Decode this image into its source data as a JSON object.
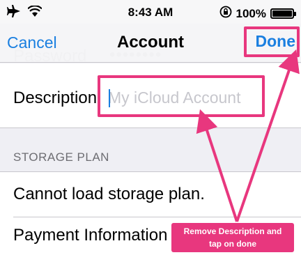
{
  "status_bar": {
    "airplane_icon": "airplane-icon",
    "wifi_icon": "wifi-icon",
    "time": "8:43 AM",
    "orientation_lock_icon": "orientation-lock-icon",
    "battery_percent": "100%",
    "battery_level": 1.0
  },
  "nav": {
    "cancel_label": "Cancel",
    "title": "Account",
    "done_label": "Done"
  },
  "background_row": {
    "label": "Password",
    "value": "••••••••"
  },
  "description": {
    "label": "Description",
    "placeholder": "My iCloud Account",
    "value": ""
  },
  "storage": {
    "header": "STORAGE PLAN",
    "status_text": "Cannot load storage plan.",
    "payment_label": "Payment Information"
  },
  "annotation": {
    "text_line1": "Remove Description and",
    "text_line2": "tap on done",
    "color": "#e8377e"
  },
  "colors": {
    "accent": "#1a7fe0",
    "highlight": "#e8377e"
  }
}
